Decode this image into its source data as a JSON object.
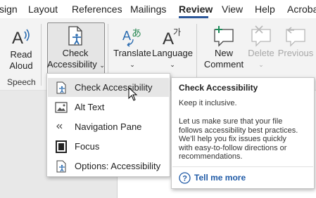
{
  "ribbon_tabs": [
    "sign",
    "Layout",
    "References",
    "Mailings",
    "Review",
    "View",
    "Help",
    "Acroba"
  ],
  "active_tab": "Review",
  "colors": {
    "accent": "#2b579a",
    "help_link": "#1f5aa6",
    "menu_highlight": "#e6e6e6"
  },
  "groups": {
    "speech": {
      "read_aloud": {
        "line1": "Read",
        "line2": "Aloud",
        "icon": "read-aloud-icon"
      },
      "label": "Speech"
    },
    "accessibility": {
      "check_accessibility": {
        "line1": "Check",
        "line2": "Accessibility",
        "chevron": "⌄",
        "icon": "check-accessibility-icon"
      }
    },
    "language": {
      "translate": {
        "label": "Translate",
        "chevron": "⌄",
        "icon": "translate-icon"
      },
      "language": {
        "label": "Language",
        "chevron": "⌄",
        "icon": "language-icon"
      }
    },
    "comments": {
      "new_comment": {
        "line1": "New",
        "line2": "Comment",
        "icon": "new-comment-icon"
      },
      "delete": {
        "label": "Delete",
        "chevron": "⌄",
        "icon": "delete-comment-icon",
        "disabled": true
      },
      "previous": {
        "label": "Previous",
        "icon": "previous-comment-icon",
        "disabled": true
      }
    }
  },
  "menu": {
    "items": [
      {
        "label": "Check Accessibility",
        "icon": "check-accessibility-icon",
        "highlighted": true
      },
      {
        "label": "Alt Text",
        "icon": "alt-text-icon"
      },
      {
        "label": "Navigation Pane",
        "icon": "navigation-pane-icon"
      },
      {
        "label": "Focus",
        "icon": "focus-icon"
      },
      {
        "label": "Options: Accessibility",
        "icon": "options-accessibility-icon"
      }
    ]
  },
  "tooltip": {
    "title": "Check Accessibility",
    "subtitle": "Keep it inclusive.",
    "body": "Let us make sure that your file\nfollows accessibility best practices.\nWe'll help you fix issues quickly\nwith easy-to-follow directions or\nrecommendations.",
    "help_link": "Tell me more",
    "help_icon": "help-circle-icon"
  }
}
